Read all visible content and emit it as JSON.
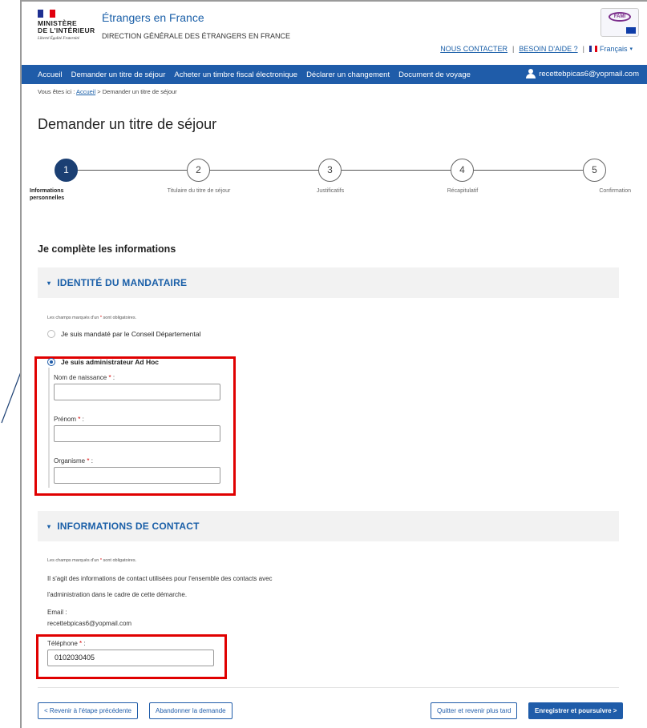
{
  "header": {
    "ministry_line1": "MINISTÈRE",
    "ministry_line2": "DE L'INTÉRIEUR",
    "motto": "Liberté Égalité Fraternité",
    "site_title": "Étrangers en France",
    "site_subtitle": "DIRECTION GÉNÉRALE DES ÉTRANGERS EN FRANCE",
    "fami_label": "FAMI",
    "contact_link": "NOUS CONTACTER",
    "help_link": "BESOIN D'AIDE ?",
    "language": "Français",
    "separator": "|"
  },
  "nav": {
    "items": [
      {
        "label": "Accueil"
      },
      {
        "label": "Demander un titre de séjour"
      },
      {
        "label": "Acheter un timbre fiscal électronique"
      },
      {
        "label": "Déclarer un changement"
      },
      {
        "label": "Document de voyage"
      }
    ],
    "user_email": "recettebpicas6@yopmail.com"
  },
  "breadcrumb": {
    "prefix": "Vous êtes ici :",
    "home": "Accueil",
    "current": "> Demander un titre de séjour"
  },
  "page_title": "Demander un titre de séjour",
  "stepper": {
    "steps": [
      {
        "number": "1",
        "label": "Informations personnelles",
        "active": true
      },
      {
        "number": "2",
        "label": "Titulaire du titre de séjour",
        "active": false
      },
      {
        "number": "3",
        "label": "Justificatifs",
        "active": false
      },
      {
        "number": "4",
        "label": "Récapitulatif",
        "active": false
      },
      {
        "number": "5",
        "label": "Confirmation",
        "active": false
      }
    ]
  },
  "section_heading": "Je complète les informations",
  "mandataire": {
    "panel_title": "IDENTITÉ DU MANDATAIRE",
    "hint_prefix": "Les champs marqués d'un",
    "hint_star": "*",
    "hint_suffix": "sont obligatoires.",
    "option_conseil": "Je suis mandaté par le Conseil Départemental",
    "option_adhoc": "Je suis administrateur Ad Hoc",
    "nom_label": "Nom de naissance",
    "prenom_label": "Prénom",
    "organisme_label": "Organisme",
    "required_mark": "*",
    "colon": ":",
    "nom_value": "",
    "prenom_value": "",
    "organisme_value": ""
  },
  "contact": {
    "panel_title": "INFORMATIONS DE CONTACT",
    "hint_prefix": "Les champs marqués d'un",
    "hint_star": "*",
    "hint_suffix": "sont obligatoires.",
    "info_line1": "Il s'agit des informations de contact utilisées pour l'ensemble des contacts avec",
    "info_line2": "l'administration dans le cadre de cette démarche.",
    "email_label": "Email :",
    "email_value": "recettebpicas6@yopmail.com",
    "phone_label": "Téléphone",
    "required_mark": "*",
    "colon": ":",
    "phone_value": "0102030405"
  },
  "buttons": {
    "back": "< Revenir à l'étape précédente",
    "abandon": "Abandonner la demande",
    "quit": "Quitter et revenir plus tard",
    "save": "Enregistrer et poursuivre >"
  },
  "colors": {
    "nav_blue": "#1f5ca9",
    "active_step": "#1b3f73",
    "highlight_red": "#e00000"
  }
}
